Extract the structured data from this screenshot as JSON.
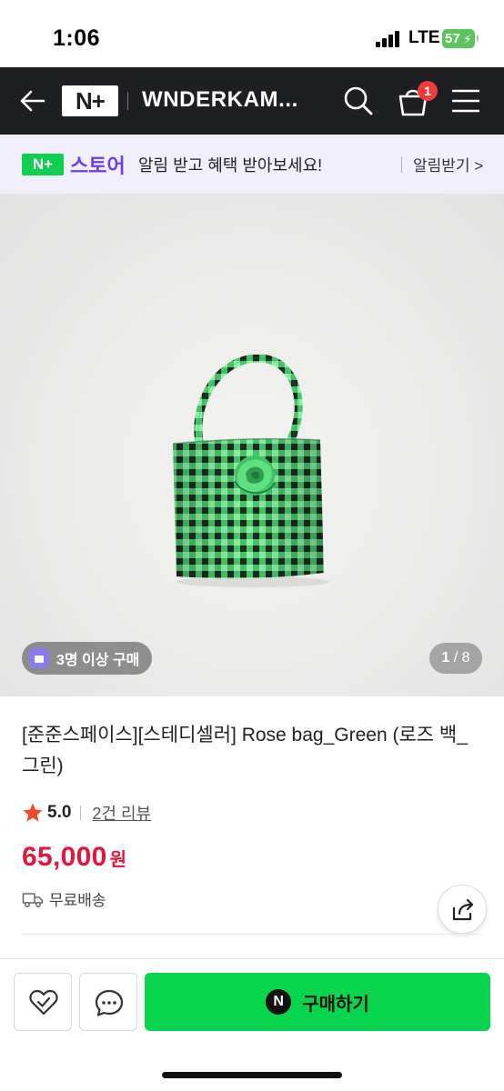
{
  "status_bar": {
    "time": "1:06",
    "network": "LTE",
    "battery": "57"
  },
  "nav": {
    "logo": "N+",
    "title": "WNDERKAM...",
    "cart_count": "1"
  },
  "notice": {
    "badge": "N+",
    "store": "스토어",
    "message": "알림 받고 혜택 받아보세요!",
    "action": "알림받기 >"
  },
  "gallery": {
    "purchase_badge": "3명 이상 구매",
    "current": "1",
    "total": "/ 8"
  },
  "product": {
    "title": "[준준스페이스][스테디셀러] Rose bag_Green (로즈 백_그린)",
    "rating": "5.0",
    "reviews": "2건 리뷰",
    "price": "65,000",
    "price_unit": "원",
    "shipping": "무료배송"
  },
  "bottom_bar": {
    "buy_label": "구매하기",
    "npay_icon": "N"
  },
  "colors": {
    "nav_bg": "#1e1f22",
    "brand_green": "#08d44e",
    "price_red": "#e0173f",
    "store_purple": "#6b3ef0",
    "notice_bg": "#f1effc"
  }
}
